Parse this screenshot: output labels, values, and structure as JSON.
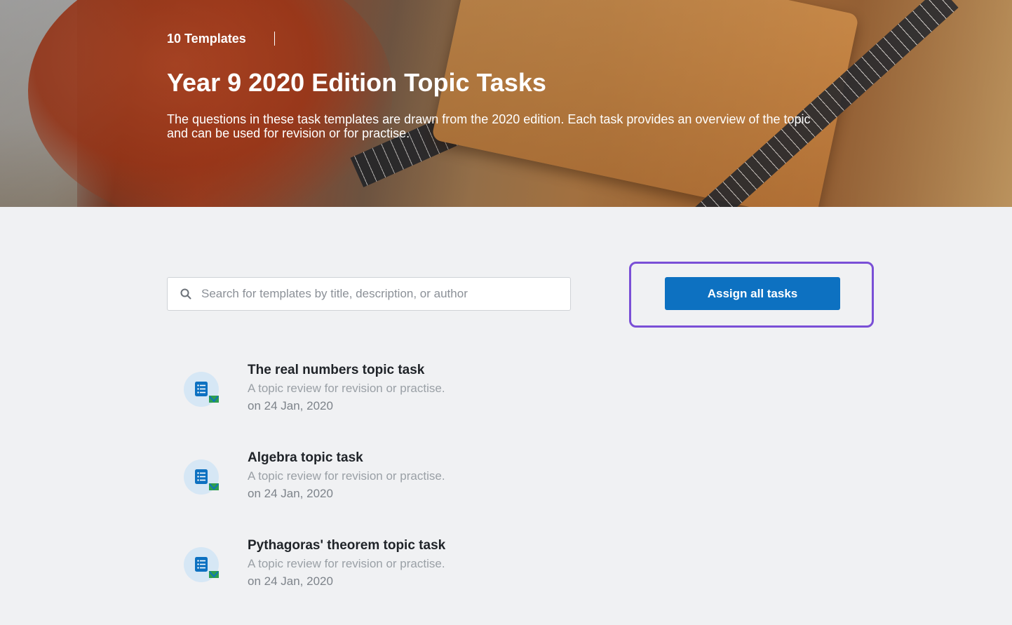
{
  "hero": {
    "count_label": "10 Templates",
    "title": "Year 9 2020 Edition Topic Tasks",
    "description": "The questions in these task templates are drawn from the 2020 edition. Each task provides an overview of the topic and can be used for revision or for practise."
  },
  "search": {
    "placeholder": "Search for templates by title, description, or author",
    "value": ""
  },
  "actions": {
    "assign_all_label": "Assign all tasks"
  },
  "templates": [
    {
      "title": "The real numbers topic task",
      "description": "A topic review for revision or practise.",
      "date": "on 24 Jan, 2020"
    },
    {
      "title": "Algebra topic task",
      "description": "A topic review for revision or practise.",
      "date": "on 24 Jan, 2020"
    },
    {
      "title": "Pythagoras' theorem topic task",
      "description": "A topic review for revision or practise.",
      "date": "on 24 Jan, 2020"
    }
  ],
  "colors": {
    "primary": "#0d71c1",
    "highlight_frame": "#7a4fd6",
    "background": "#f0f1f3",
    "icon_bg": "#d6e7f5",
    "icon_accent": "#2e9e4f"
  },
  "icons": {
    "search": "search-icon",
    "template": "task-template-icon"
  }
}
